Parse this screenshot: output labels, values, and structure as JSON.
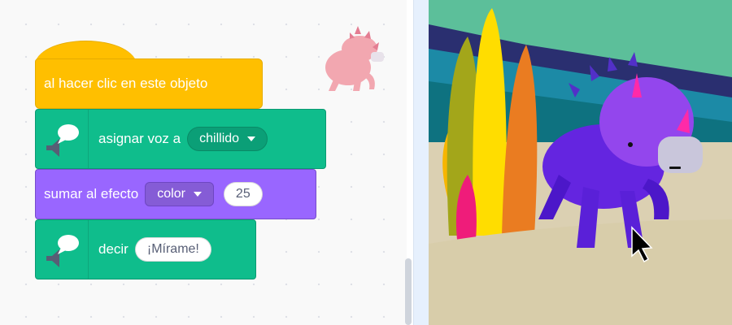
{
  "blocks": {
    "event": {
      "label": "al hacer clic en este objeto"
    },
    "set_voice": {
      "label": "asignar voz a",
      "voice": "chillido"
    },
    "change_effect": {
      "label": "sumar al efecto",
      "effect": "color",
      "amount": "25"
    },
    "say": {
      "label": "decir",
      "text": "¡Mírame!"
    }
  },
  "colors": {
    "events": "#ffbf00",
    "text2speech": "#0fbd8c",
    "looks": "#9966ff"
  },
  "icons": [
    "speaker-speech-icon",
    "dropdown-caret-icon",
    "mouse-cursor-icon"
  ],
  "sprite": {
    "name": ""
  }
}
